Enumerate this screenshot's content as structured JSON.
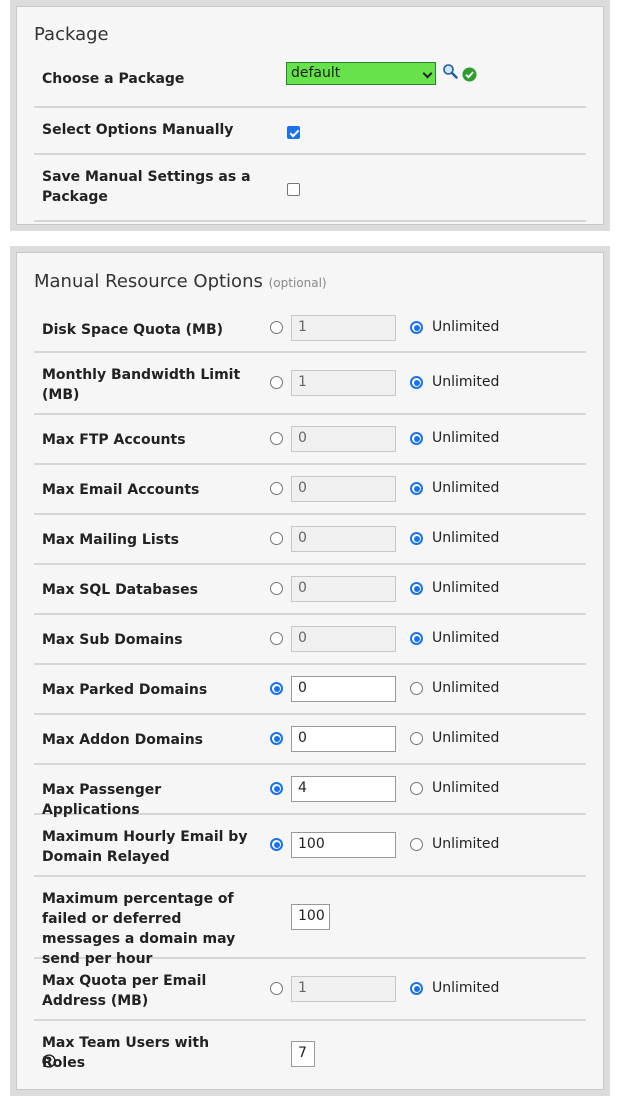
{
  "package": {
    "title": "Package",
    "choose_label": "Choose a Package",
    "selected_package": "default",
    "select_manual_label": "Select Options Manually",
    "select_manual_checked": true,
    "save_manual_label": "Save Manual Settings as a Package",
    "save_manual_checked": false
  },
  "manual": {
    "title": "Manual Resource Options",
    "optional": "(optional)",
    "unlimited_label": "Unlimited",
    "rows": [
      {
        "label": "Disk Space Quota (MB)",
        "value": "1",
        "unlimited": true
      },
      {
        "label": "Monthly Bandwidth Limit (MB)",
        "value": "1",
        "unlimited": true
      },
      {
        "label": "Max FTP Accounts",
        "value": "0",
        "unlimited": true
      },
      {
        "label": "Max Email Accounts",
        "value": "0",
        "unlimited": true
      },
      {
        "label": "Max Mailing Lists",
        "value": "0",
        "unlimited": true
      },
      {
        "label": "Max SQL Databases",
        "value": "0",
        "unlimited": true
      },
      {
        "label": "Max Sub Domains",
        "value": "0",
        "unlimited": true
      },
      {
        "label": "Max Parked Domains",
        "value": "0",
        "unlimited": false
      },
      {
        "label": "Max Addon Domains",
        "value": "0",
        "unlimited": false
      },
      {
        "label": "Max Passenger Applications",
        "value": "4",
        "unlimited": false
      },
      {
        "label": "Maximum Hourly Email by Domain Relayed",
        "value": "100",
        "unlimited": false
      },
      {
        "label": "Maximum percentage of failed or deferred messages a domain may send per hour",
        "value": "100"
      },
      {
        "label": "Max Quota per Email Address (MB)",
        "value": "1",
        "unlimited": true
      },
      {
        "label": "Max Team Users with Roles",
        "value": "7"
      }
    ]
  },
  "colors": {
    "package_select_bg": "#66e24a",
    "radio_checked": "#1a73e8",
    "ok_icon": "#2e9e2e"
  },
  "icons": [
    "search-icon",
    "check-circle-icon",
    "help-icon"
  ]
}
